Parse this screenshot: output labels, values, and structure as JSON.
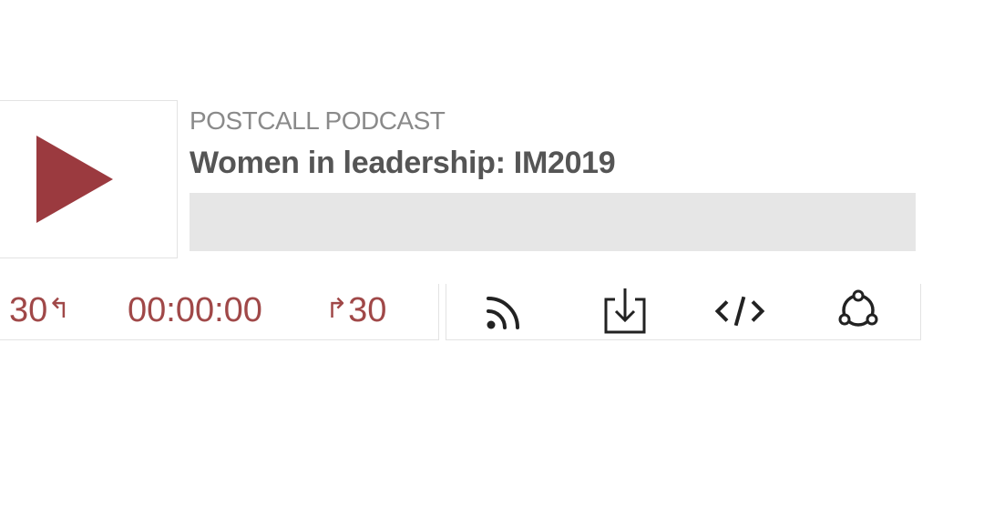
{
  "player": {
    "podcast_name": "POSTCALL PODCAST",
    "episode_title": "Women in leadership: IM2019",
    "progress_fraction": 0,
    "rewind_label": "30",
    "rewind_glyph": "↰",
    "time": "00:00:00",
    "forward_glyph": "↱",
    "forward_label": "30",
    "icons": {
      "play": "play-icon",
      "rss": "rss-icon",
      "download": "download-icon",
      "embed": "embed-code-icon",
      "share": "share-icon"
    },
    "colors": {
      "accent": "#9b3a3f",
      "control_text": "#a04848",
      "title": "#555555",
      "subtitle": "#8a8a8a",
      "progress_bg": "#e6e6e6"
    }
  }
}
